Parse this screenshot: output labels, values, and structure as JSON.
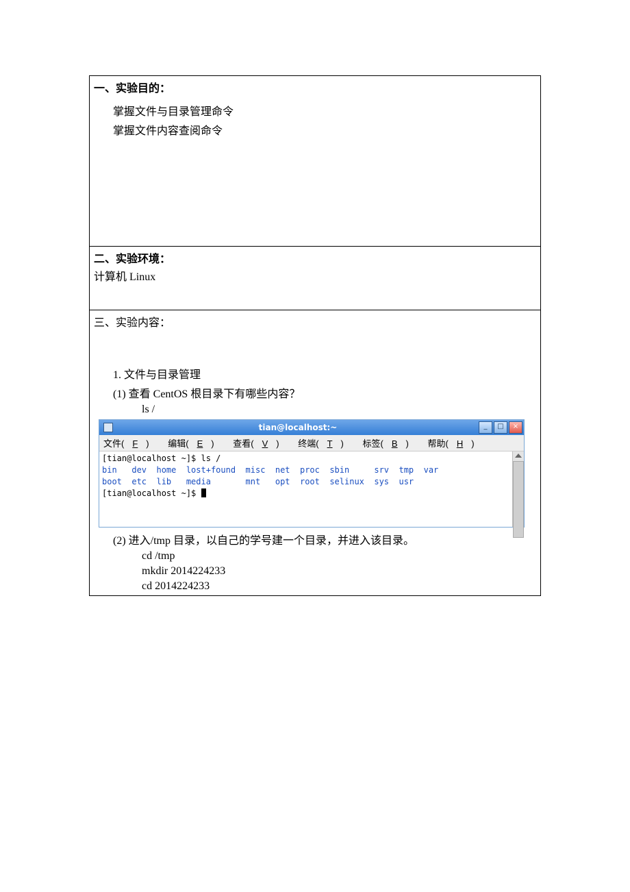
{
  "section1": {
    "heading": "一、实验目的：",
    "line1": "掌握文件与目录管理命令",
    "line2": "掌握文件内容查阅命令"
  },
  "section2": {
    "heading": "二、实验环境：",
    "line1": "计算机  Linux"
  },
  "section3": {
    "heading": "三、实验内容：",
    "item1_head": "1. 文件与目录管理",
    "item1_1": "(1)  查看 CentOS 根目录下有哪些内容？",
    "item1_1_cmd": "ls    /",
    "item1_2": "(2)  进入/tmp 目录，以自己的学号建一个目录，并进入该目录。",
    "item1_2_cmd1": "cd    /tmp",
    "item1_2_cmd2": "mkdir 2014224233",
    "item1_2_cmd3": "cd 2014224233"
  },
  "terminal": {
    "title": "tian@localhost:~",
    "menu": {
      "file": "文件(",
      "file_u": "F",
      "file_end": ")",
      "edit": "编辑(",
      "edit_u": "E",
      "edit_end": ")",
      "view": "查看(",
      "view_u": "V",
      "view_end": ")",
      "term": "终端(",
      "term_u": "T",
      "term_end": ")",
      "tabs": "标签(",
      "tabs_u": "B",
      "tabs_end": ")",
      "help": "帮助(",
      "help_u": "H",
      "help_end": ")"
    },
    "lines": {
      "l0_a": "[tian@localhost ~]$ ls /",
      "l1_dirs": "bin   dev  home  lost+found  misc  net  proc  sbin     srv  tmp  var",
      "l2_dirs": "boot  etc  lib   media       mnt   opt  root  selinux  sys  usr",
      "l3_a": "[tian@localhost ~]$ "
    },
    "controls": {
      "min": "_",
      "max": "□",
      "close": "×"
    }
  }
}
